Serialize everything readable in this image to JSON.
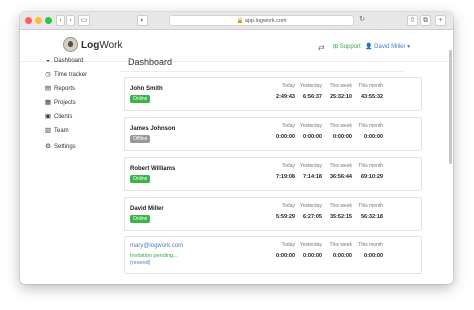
{
  "browser": {
    "url": "app.logwork.com",
    "colors": {
      "close": "#fe5f57",
      "minimize": "#febc2e",
      "zoom": "#28c840"
    }
  },
  "header": {
    "logo_strong": "Log",
    "logo_light": "Work",
    "support_label": "Support",
    "user_label": "David Miller",
    "accent": "#4a7cc7"
  },
  "sidebar": {
    "items": [
      {
        "label": "Dashboard",
        "icon": "dashboard-icon"
      },
      {
        "label": "Time tracker",
        "icon": "clock-icon"
      },
      {
        "label": "Reports",
        "icon": "chart-icon"
      },
      {
        "label": "Projects",
        "icon": "projects-icon"
      },
      {
        "label": "Clients",
        "icon": "clients-icon"
      },
      {
        "label": "Team",
        "icon": "team-icon"
      },
      {
        "label": "Settings",
        "icon": "gear-icon"
      }
    ]
  },
  "main": {
    "title": "Dashboard",
    "columns": [
      "Today",
      "Yesterday",
      "This week",
      "This month"
    ],
    "members": [
      {
        "name": "John Smith",
        "status": "Online",
        "values": [
          "2:49:43",
          "6:56:37",
          "25:32:10",
          "43:55:32"
        ]
      },
      {
        "name": "James Johnson",
        "status": "Offline",
        "values": [
          "0:00:00",
          "0:00:00",
          "0:00:00",
          "0:00:00"
        ]
      },
      {
        "name": "Robert Williams",
        "status": "Online",
        "values": [
          "7:19:08",
          "7:14:18",
          "36:56:44",
          "69:10:29"
        ]
      },
      {
        "name": "David Miller",
        "status": "Online",
        "values": [
          "5:59:29",
          "6:27:05",
          "35:52:15",
          "56:32:18"
        ]
      }
    ],
    "invite": {
      "email": "mary@logwork.com",
      "pending": "Invitation pending...",
      "resend": "(resend)",
      "values": [
        "0:00:00",
        "0:00:00",
        "0:00:00",
        "0:00:00"
      ]
    }
  }
}
